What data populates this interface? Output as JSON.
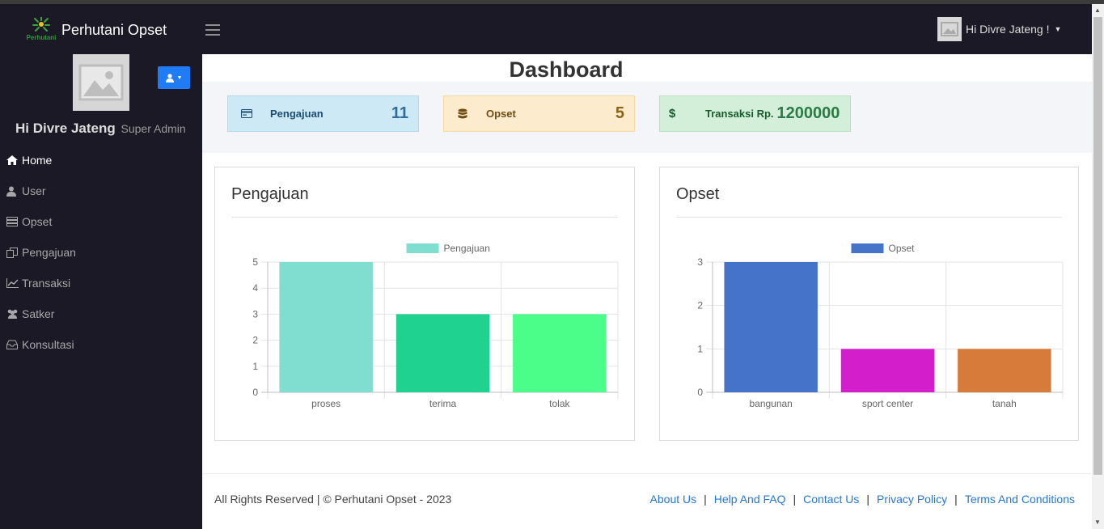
{
  "app": {
    "title": "Perhutani Opset",
    "logo_text": "Perhutani"
  },
  "topbar": {
    "user_greeting": "Hi Divre Jateng !"
  },
  "sidebar": {
    "greeting": "Hi Divre Jateng",
    "role": "Super Admin",
    "items": [
      {
        "label": "Home",
        "icon": "home-icon",
        "active": true
      },
      {
        "label": "User",
        "icon": "user-icon",
        "active": false
      },
      {
        "label": "Opset",
        "icon": "server-icon",
        "active": false
      },
      {
        "label": "Pengajuan",
        "icon": "copy-icon",
        "active": false
      },
      {
        "label": "Transaksi",
        "icon": "line-chart-icon",
        "active": false
      },
      {
        "label": "Satker",
        "icon": "users-icon",
        "active": false
      },
      {
        "label": "Konsultasi",
        "icon": "inbox-icon",
        "active": false
      }
    ]
  },
  "main": {
    "title": "Dashboard",
    "stats": [
      {
        "label": "Pengajuan",
        "value": "11",
        "icon": "card-icon"
      },
      {
        "label": "Opset",
        "value": "5",
        "icon": "database-icon"
      },
      {
        "label": "Transaksi Rp.",
        "value": "1200000",
        "icon": "dollar-icon"
      }
    ],
    "cards": [
      {
        "title": "Pengajuan"
      },
      {
        "title": "Opset"
      }
    ]
  },
  "chart_data": [
    {
      "type": "bar",
      "categories": [
        "proses",
        "terima",
        "tolak"
      ],
      "series": [
        {
          "name": "Pengajuan",
          "values": [
            5,
            3,
            3
          ]
        }
      ],
      "colors": [
        "#7fded0",
        "#1fd290",
        "#4bfe8a"
      ],
      "ylim": [
        0,
        5
      ],
      "yticks": [
        0,
        1,
        2,
        3,
        4,
        5
      ],
      "legend": "top",
      "grid": true
    },
    {
      "type": "bar",
      "categories": [
        "bangunan",
        "sport center",
        "tanah"
      ],
      "series": [
        {
          "name": "Opset",
          "values": [
            3,
            1,
            1
          ]
        }
      ],
      "colors": [
        "#4573c9",
        "#d31ecb",
        "#d67b3a"
      ],
      "legend_color": "#4573c9",
      "ylim": [
        0,
        3
      ],
      "yticks": [
        0,
        1,
        2,
        3
      ],
      "legend": "top",
      "grid": true
    }
  ],
  "footer": {
    "copyright": "All Rights Reserved | © Perhutani Opset - 2023",
    "links": [
      "About Us",
      "Help And FAQ",
      "Contact Us",
      "Privacy Policy",
      "Terms And Conditions"
    ],
    "separator": "|"
  }
}
